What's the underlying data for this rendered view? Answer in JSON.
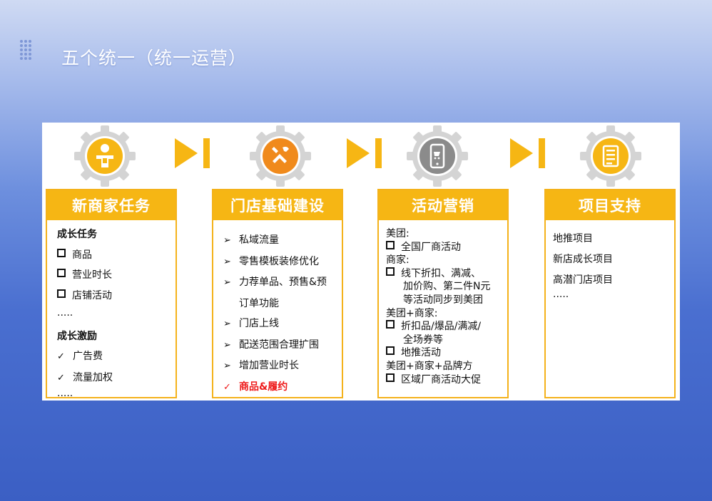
{
  "title": "五个统一（统一运营）",
  "cards": [
    {
      "heading": "新商家任务",
      "lines": [
        "成长任务",
        "商品",
        "营业时长",
        "店铺活动",
        "·····",
        "成长激励",
        "广告费",
        "流量加权",
        "·····"
      ],
      "markers": {
        "check": "✓"
      }
    },
    {
      "heading": "门店基础建设",
      "lines": [
        "私域流量",
        "零售模板装修优化",
        "力荐单品、预售&预",
        "订单功能",
        "门店上线",
        "配送范围合理扩围",
        "增加营业时长",
        "商品&履约"
      ],
      "markers": {
        "arrow": "➢",
        "check": "✓"
      }
    },
    {
      "heading": "活动营销",
      "lines": [
        "美团:",
        "全国厂商活动",
        "商家:",
        "线下折扣、满减、",
        "加价购、第二件N元",
        "等活动同步到美团",
        "美团+商家:",
        "折扣品/爆品/满减/",
        "全场券等",
        "地推活动",
        "美团+商家+品牌方",
        "区域厂商活动大促"
      ]
    },
    {
      "heading": "项目支持",
      "lines": [
        "地推项目",
        "新店成长项目",
        "高潜门店项目",
        "·····"
      ]
    }
  ],
  "icons": [
    "person-icon",
    "tools-icon",
    "phone-cart-icon",
    "document-icon"
  ],
  "colors": {
    "accent": "#f6b614",
    "icon_orange": "#f08a1c",
    "icon_yellow": "#f6b614",
    "icon_gray": "#8b8b8b",
    "highlight": "#ee1b1b"
  }
}
